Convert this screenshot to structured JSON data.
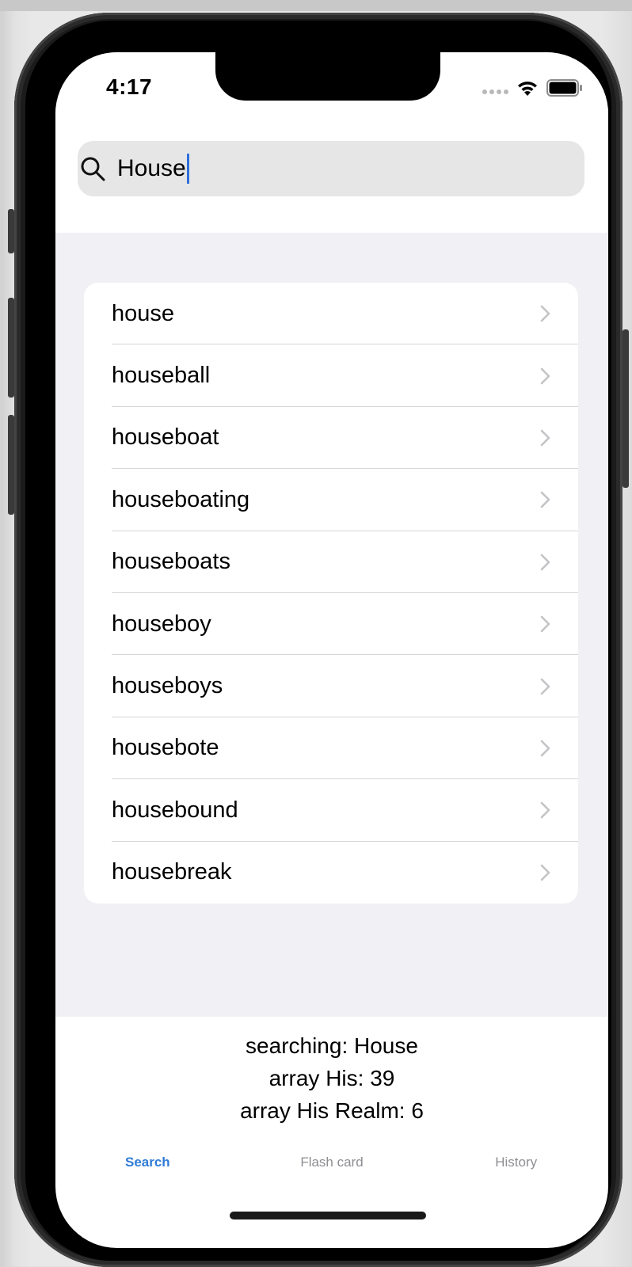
{
  "status_bar": {
    "time": "4:17",
    "wifi_icon": "wifi-icon",
    "battery_icon": "battery-icon"
  },
  "search": {
    "value": "House",
    "icon": "search-icon"
  },
  "results": [
    {
      "label": "house"
    },
    {
      "label": "houseball"
    },
    {
      "label": "houseboat"
    },
    {
      "label": "houseboating"
    },
    {
      "label": "houseboats"
    },
    {
      "label": "houseboy"
    },
    {
      "label": "houseboys"
    },
    {
      "label": "housebote"
    },
    {
      "label": "housebound"
    },
    {
      "label": "housebreak"
    }
  ],
  "debug": {
    "searching": "searching: House",
    "array_his": "array His: 39",
    "array_his_realm": "array His Realm: 6"
  },
  "tabs": [
    {
      "label": "Search",
      "active": true
    },
    {
      "label": "Flash card",
      "active": false
    },
    {
      "label": "History",
      "active": false
    }
  ],
  "colors": {
    "accent": "#2f7cd6",
    "caret": "#2f6fdb",
    "list_background": "#f1f1f5",
    "search_field": "#e6e6e6"
  }
}
